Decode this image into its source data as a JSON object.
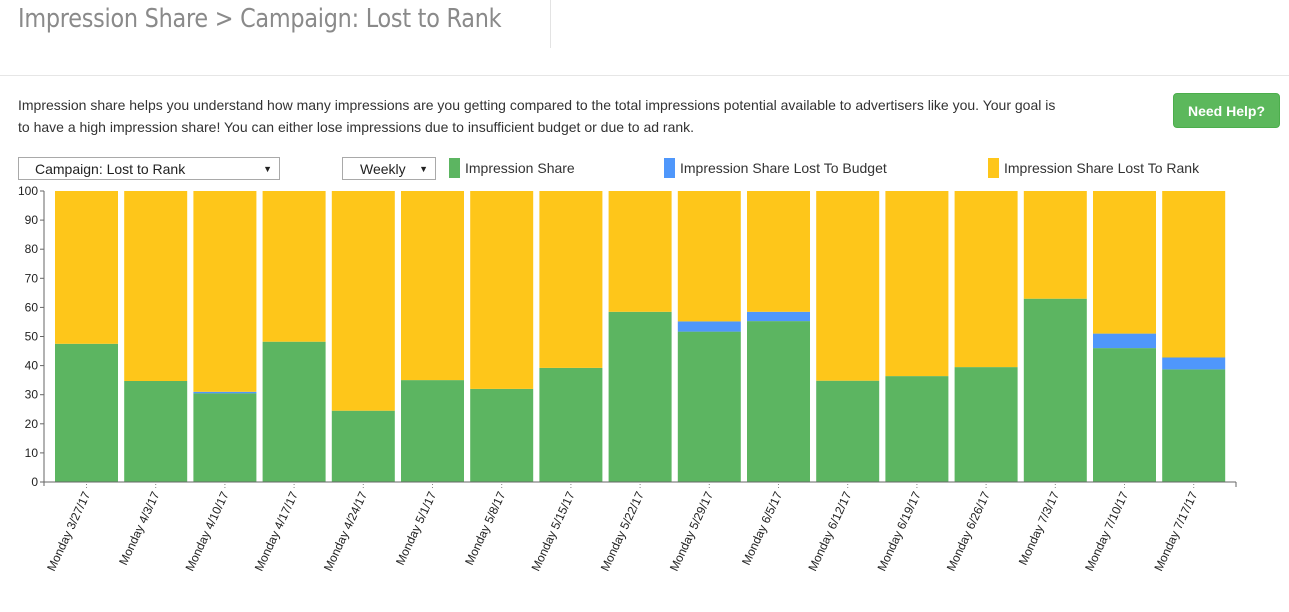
{
  "header": {
    "title": "Impression Share > Campaign: Lost to Rank"
  },
  "description": "Impression share helps you understand how many impressions are you getting compared to the total impressions potential available to advertisers like you. Your goal is to have a high impression share! You can either lose impressions due to insufficient budget or due to ad rank.",
  "help_button": {
    "label": "Need Help?"
  },
  "controls": {
    "campaign_select": {
      "selected": "Campaign: Lost to Rank",
      "arrow": "▼"
    },
    "period_select": {
      "selected": "Weekly",
      "arrow": "▼"
    }
  },
  "legend": [
    {
      "label": "Impression Share",
      "color": "#5cb561"
    },
    {
      "label": "Impression Share Lost To Budget",
      "color": "#4f97fb"
    },
    {
      "label": "Impression Share Lost To Rank",
      "color": "#fec61a"
    }
  ],
  "chart_data": {
    "type": "bar",
    "stacked": true,
    "title": "",
    "xlabel": "",
    "ylabel": "",
    "ylim": [
      0,
      100
    ],
    "yticks": [
      0,
      10,
      20,
      30,
      40,
      50,
      60,
      70,
      80,
      90,
      100
    ],
    "grid": false,
    "legend_position": "top",
    "categories": [
      "Monday 3/27/17",
      "Monday 4/3/17",
      "Monday 4/10/17",
      "Monday 4/17/17",
      "Monday 4/24/17",
      "Monday 5/1/17",
      "Monday 5/8/17",
      "Monday 5/15/17",
      "Monday 5/22/17",
      "Monday 5/29/17",
      "Monday 6/5/17",
      "Monday 6/12/17",
      "Monday 6/19/17",
      "Monday 6/26/17",
      "Monday 7/3/17",
      "Monday 7/10/17",
      "Monday 7/17/17"
    ],
    "series": [
      {
        "name": "Impression Share",
        "color": "#5cb561",
        "values": [
          47.5,
          34.7,
          30.5,
          48.2,
          24.5,
          35.0,
          32.0,
          39.2,
          58.5,
          51.7,
          55.3,
          34.8,
          36.4,
          39.5,
          63.0,
          46.0,
          38.7
        ]
      },
      {
        "name": "Impression Share Lost To Budget",
        "color": "#4f97fb",
        "values": [
          0,
          0,
          0.5,
          0,
          0,
          0,
          0,
          0,
          0,
          3.5,
          3.2,
          0,
          0,
          0,
          0,
          5.0,
          4.1
        ]
      },
      {
        "name": "Impression Share Lost To Rank",
        "color": "#fec61a",
        "values": [
          52.5,
          65.3,
          69.0,
          51.8,
          75.5,
          65.0,
          68.0,
          60.8,
          41.5,
          44.8,
          41.5,
          65.2,
          63.6,
          60.5,
          37.0,
          49.0,
          57.2
        ]
      }
    ]
  }
}
